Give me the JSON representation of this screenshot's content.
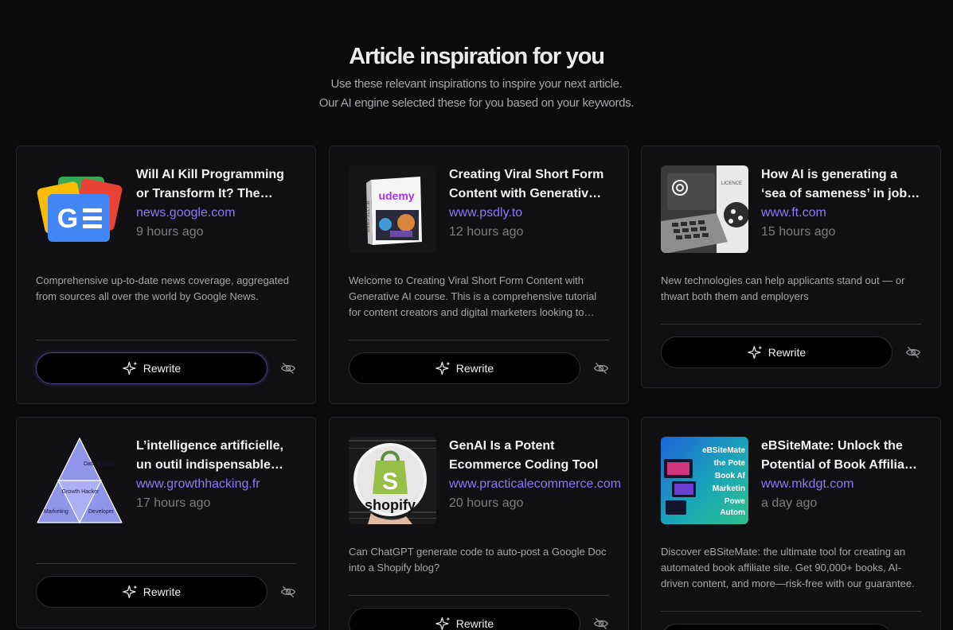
{
  "header": {
    "title": "Article inspiration for you",
    "subtitle_line1": "Use these relevant inspirations to inspire your next article.",
    "subtitle_line2": "Our AI engine selected these for you based on your keywords."
  },
  "button_label": "Rewrite",
  "colors": {
    "accent": "#8f77f7",
    "background": "#0b0b0c",
    "card": "#101012"
  },
  "cards": [
    {
      "title": "Will AI Kill Programming or Transform It? The Future of Coding",
      "source": "news.google.com",
      "time": "9 hours ago",
      "description": "Comprehensive up-to-date news coverage, aggregated from sources all over the world by Google News.",
      "thumb_icon": "google-news-logo"
    },
    {
      "title": "Creating Viral Short Form Content with Generative AI",
      "source": "www.psdly.to",
      "time": "12 hours ago",
      "description": "Welcome to Creating Viral Short Form Content with Generative AI course. This is a comprehensive tutorial for content creators and digital marketers looking to grow.",
      "thumb_icon": "udemy-course-box",
      "thumb_text": "udemy",
      "thumb_side_text": "www.PSDLY.to"
    },
    {
      "title": "How AI is generating a ‘sea of sameness’ in job applications",
      "source": "www.ft.com",
      "time": "15 hours ago",
      "description": "New technologies can help applicants stand out — or thwart both them and employers",
      "thumb_icon": "openai-laptop-illustration",
      "thumb_text": "LICENCE"
    },
    {
      "title": "L’intelligence artificielle, un outil indispensable pour le growth hacker",
      "source": "www.growthhacking.fr",
      "time": "17 hours ago",
      "description": "",
      "thumb_icon": "growth-hacker-triangle",
      "thumb_labels": [
        "Data Analyst",
        "Growth Hacker",
        "Marketing",
        "Developer"
      ]
    },
    {
      "title": "GenAI Is a Potent Ecommerce Coding Tool",
      "source": "www.practicalecommerce.com",
      "time": "20 hours ago",
      "description": "Can ChatGPT generate code to auto-post a Google Doc into a Shopify blog?",
      "thumb_icon": "shopify-bag-logo",
      "thumb_text": "shopify"
    },
    {
      "title": "eBSiteMate: Unlock the Potential of Book Affiliate Marketing",
      "source": "www.mkdgt.com",
      "time": "a day ago",
      "description": "Discover eBSiteMate: the ultimate tool for creating an automated book affiliate site. Get 90,000+ books, AI-driven content, and more—risk-free with our guarantee.",
      "thumb_icon": "ebsitemate-promo-image",
      "thumb_lines": [
        "eBSiteMate",
        "the Pote",
        "Book Af",
        "Marketin",
        "Powe",
        "Autom"
      ]
    }
  ]
}
